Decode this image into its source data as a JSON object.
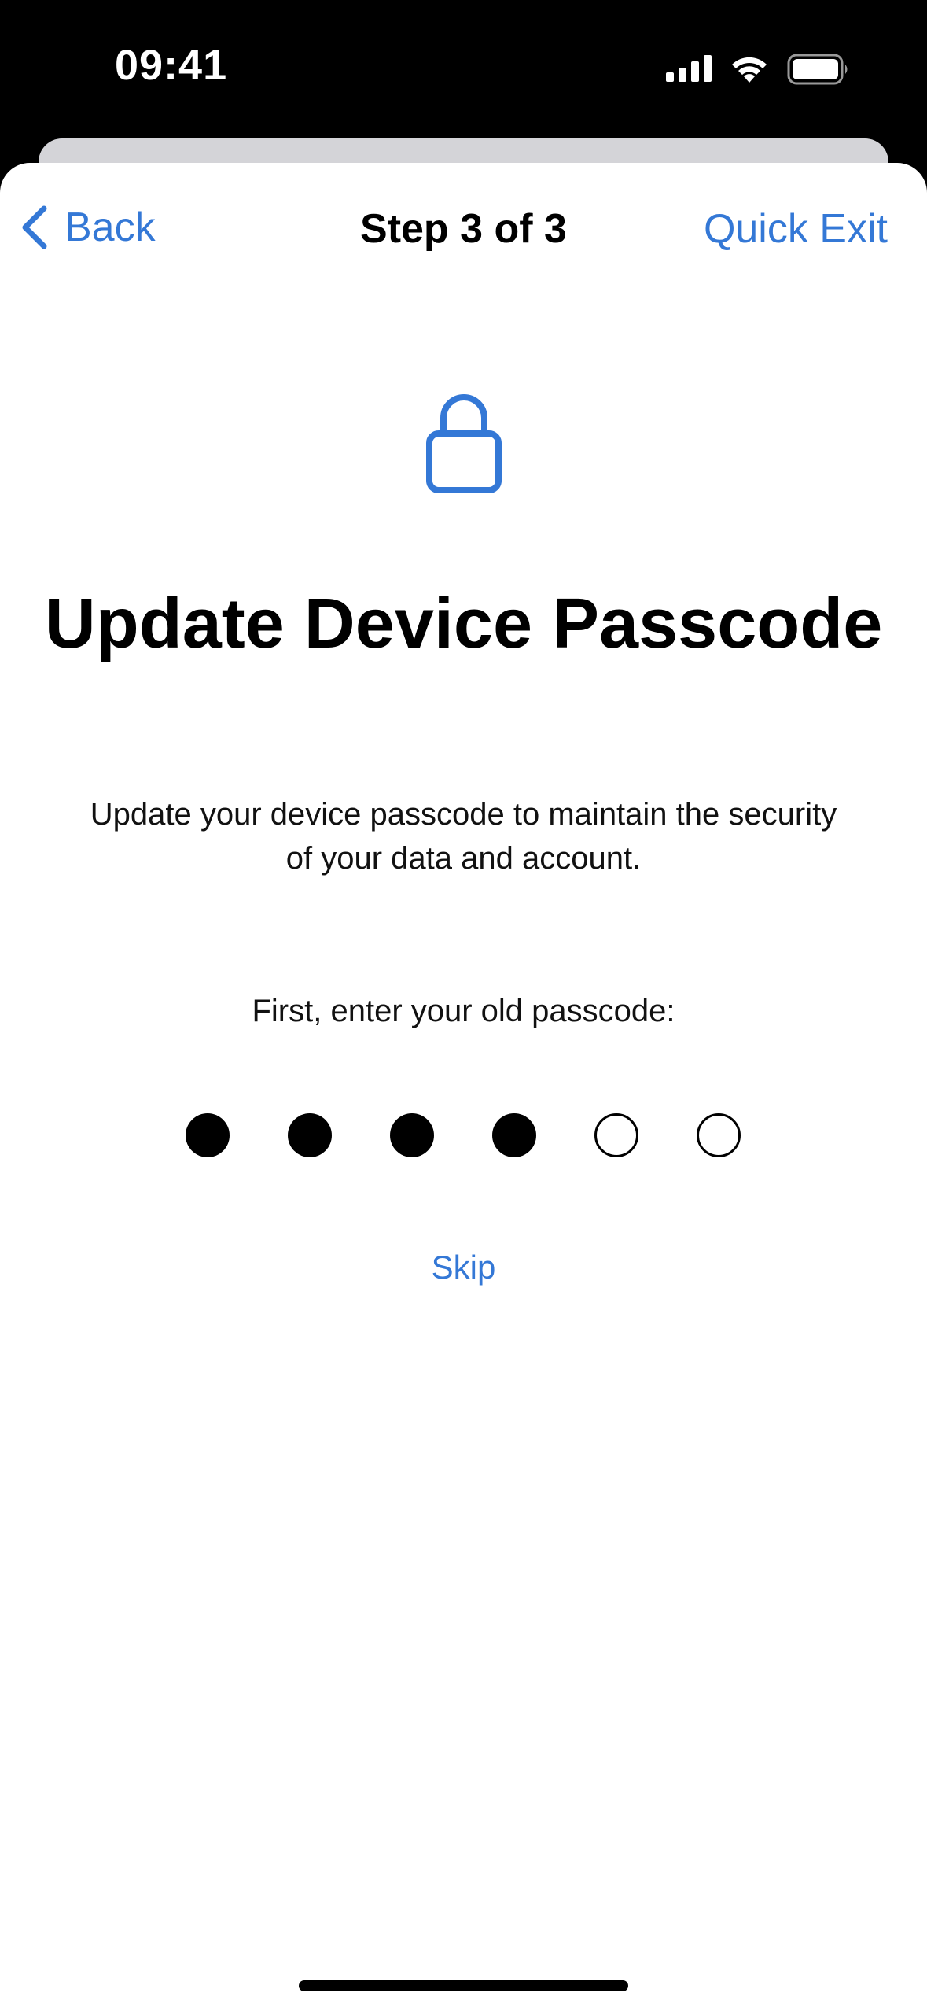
{
  "status_bar": {
    "time": "09:41",
    "icons": [
      "cellular-signal-icon",
      "wifi-icon",
      "battery-icon"
    ]
  },
  "nav": {
    "back_label": "Back",
    "title": "Step 3 of 3",
    "quick_exit_label": "Quick Exit"
  },
  "content": {
    "icon": "lock-icon",
    "title": "Update Device Passcode",
    "subtitle": "Update your device passcode to maintain the security of your data and account.",
    "prompt": "First, enter your old passcode:",
    "passcode": {
      "length": 6,
      "entered": 4
    },
    "skip_label": "Skip"
  },
  "colors": {
    "accent": "#3478d6",
    "background": "#ffffff",
    "status_bar_bg": "#000000",
    "sheet_back": "#d4d4d8"
  }
}
